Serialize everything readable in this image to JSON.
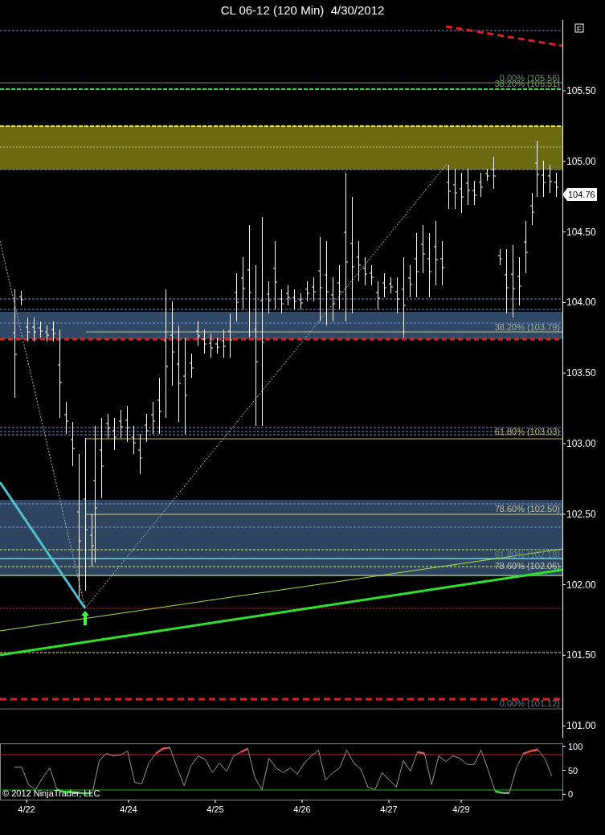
{
  "window": {
    "title": "CL 06-12 (120 Min)  4/30/2012"
  },
  "price_panel": {
    "flag": "F",
    "last_price": "104.76",
    "y_axis_labels": [
      "105.50",
      "105.00",
      "104.50",
      "104.00",
      "103.50",
      "103.00",
      "102.50",
      "102.00",
      "101.50",
      "101.00"
    ],
    "fib_labels": [
      {
        "text": "0.00% (105.56)",
        "color": "#6f8f6f"
      },
      {
        "text": "38.20% (105.51)",
        "color": "#6f9f6f"
      },
      {
        "text": "38.20% (103.79)",
        "color": "#a8b0a0"
      },
      {
        "text": "61.80% (103.03)",
        "color": "#c8b870"
      },
      {
        "text": "78.60% (102.50)",
        "color": "#c8c0a0"
      },
      {
        "text": "61.80% (102.18)",
        "color": "#6a8a9a"
      },
      {
        "text": "78.60% (102.06)",
        "color": "#c0c8c0"
      },
      {
        "text": "0.00% (101.12)",
        "color": "#6a7a8a"
      }
    ]
  },
  "indicator_panel": {
    "copyright": "© 2012 NinjaTrader, LLC",
    "chart_data": {
      "type": "line",
      "ylim": [
        -11,
        106
      ],
      "yticks": [
        100,
        50,
        0
      ],
      "series": [
        {
          "color": "#999999",
          "values": [
            57,
            57,
            20,
            10,
            35,
            55,
            10,
            5,
            5,
            3,
            2,
            3,
            70,
            85,
            80,
            82,
            90,
            25,
            22,
            65,
            85,
            95,
            97,
            55,
            18,
            60,
            80,
            72,
            45,
            65,
            48,
            80,
            88,
            95,
            35,
            10,
            75,
            55,
            45,
            55,
            42,
            65,
            80,
            92,
            30,
            45,
            55,
            92,
            65,
            52,
            15,
            10,
            45,
            30,
            15,
            70,
            48,
            88,
            85,
            20,
            80,
            68,
            80,
            75,
            62,
            62,
            92,
            50,
            6,
            3,
            3,
            55,
            85,
            90,
            93,
            75,
            38
          ]
        }
      ]
    }
  },
  "x_axis_labels": [
    "4/22",
    "4/24",
    "4/25",
    "4/26",
    "4/27",
    "4/29"
  ]
}
